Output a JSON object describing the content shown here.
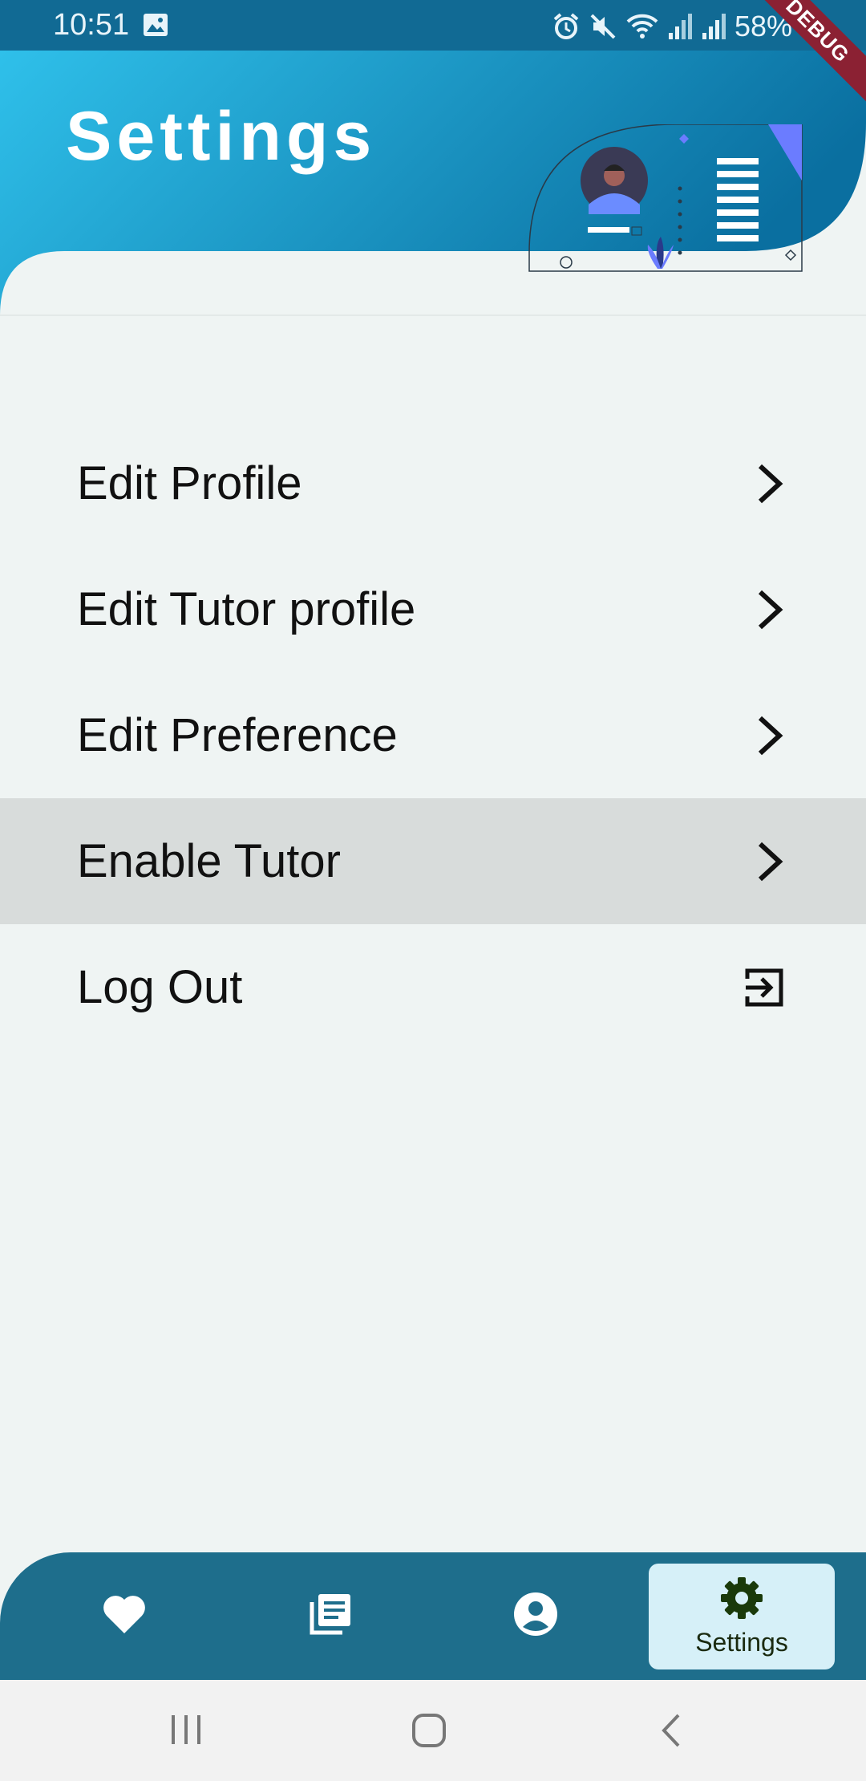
{
  "status_bar": {
    "time": "10:51",
    "battery": "58%",
    "icons": [
      "image-icon",
      "alarm-icon",
      "mute-icon",
      "wifi-icon",
      "signal-icon",
      "signal-icon",
      "battery-icon"
    ]
  },
  "debug_banner": "DEBUG",
  "header": {
    "title": "Settings"
  },
  "menu": {
    "items": [
      {
        "label": "Edit Profile",
        "icon": "chevron-right-icon"
      },
      {
        "label": "Edit Tutor profile",
        "icon": "chevron-right-icon"
      },
      {
        "label": "Edit Preference",
        "icon": "chevron-right-icon"
      },
      {
        "label": "Enable Tutor",
        "icon": "chevron-right-icon",
        "selected": true
      },
      {
        "label": "Log Out",
        "icon": "logout-icon"
      }
    ]
  },
  "bottom_nav": {
    "items": [
      {
        "icon": "heart-icon"
      },
      {
        "icon": "article-icon"
      },
      {
        "icon": "account-circle-icon"
      },
      {
        "icon": "gear-icon",
        "label": "Settings",
        "active": true
      }
    ]
  },
  "colors": {
    "header_gradient_start": "#2fc0ea",
    "header_gradient_end": "#0a6fa0",
    "nav_bar": "#1e6e8c",
    "nav_active_bg": "#d6f0f8",
    "selected_row": "#d8dcdb",
    "background": "#eff4f3"
  }
}
